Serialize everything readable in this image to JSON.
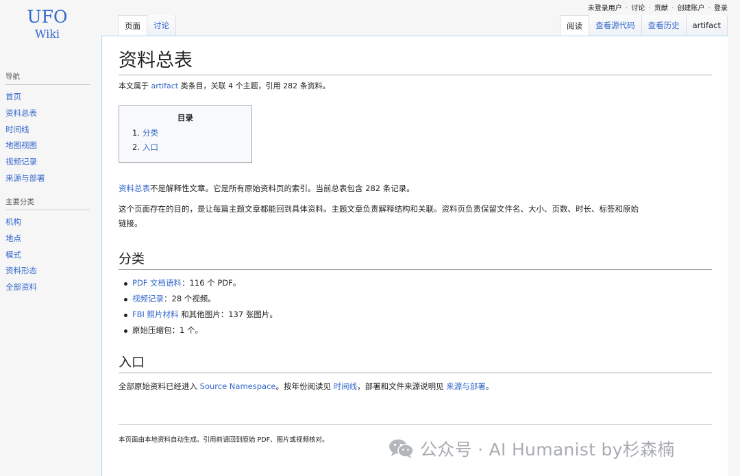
{
  "logo": {
    "line1": "UFO",
    "line2": "Wiki"
  },
  "sidebar": {
    "nav_heading": "导航",
    "nav_items": [
      "首页",
      "资料总表",
      "时间线",
      "地图视图",
      "视频记录",
      "来源与部署"
    ],
    "cat_heading": "主要分类",
    "cat_items": [
      "机构",
      "地点",
      "模式",
      "资料形态",
      "全部资料"
    ]
  },
  "personal": {
    "not_logged_in": "未登录用户",
    "talk": "讨论",
    "contributions": "贡献",
    "create_account": "创建账户",
    "login": "登录",
    "separator": "·"
  },
  "tabs_left": [
    "页面",
    "讨论"
  ],
  "tabs_right": [
    "阅读",
    "查看源代码",
    "查看历史",
    "artifact"
  ],
  "article": {
    "title": "资料总表",
    "sub_prefix": "本文属于 ",
    "sub_link": "artifact",
    "sub_suffix": " 类条目，关联 4 个主题，引用 282 条资料。",
    "toc": {
      "title": "目录",
      "items": [
        {
          "num": "1.",
          "label": "分类"
        },
        {
          "num": "2.",
          "label": "入口"
        }
      ]
    },
    "p1_link": "资料总表",
    "p1_text": "不是解释性文章。它是所有原始资料页的索引。当前总表包含 282 条记录。",
    "p2_text": "这个页面存在的目的，是让每篇主题文章都能回到具体资料。主题文章负责解释结构和关联。资料页负责保留文件名、大小、页数、时长、标签和原始链接。",
    "section1": {
      "heading": "分类",
      "items": [
        {
          "link": "PDF 文档语料",
          "text": "：116 个 PDF。"
        },
        {
          "link": "视频记录",
          "text": "：28 个视频。"
        },
        {
          "link": "FBI 照片材料",
          "text": " 和其他图片：137 张图片。"
        },
        {
          "link": "",
          "text": "原始压缩包：1 个。"
        }
      ]
    },
    "section2": {
      "heading": "入口",
      "t1": "全部原始资料已经进入 ",
      "l1": "Source Namespace",
      "t2": "。按年份阅读见 ",
      "l2": "时间线",
      "t3": "，部署和文件来源说明见 ",
      "l3": "来源与部署",
      "t4": "。"
    },
    "footer": "本页面由本地资料自动生成。引用前请回到原始 PDF、图片或视频核对。"
  },
  "watermark": {
    "text": "公众号 · AI Humanist by杉森楠",
    "icon": "wechat-icon"
  }
}
